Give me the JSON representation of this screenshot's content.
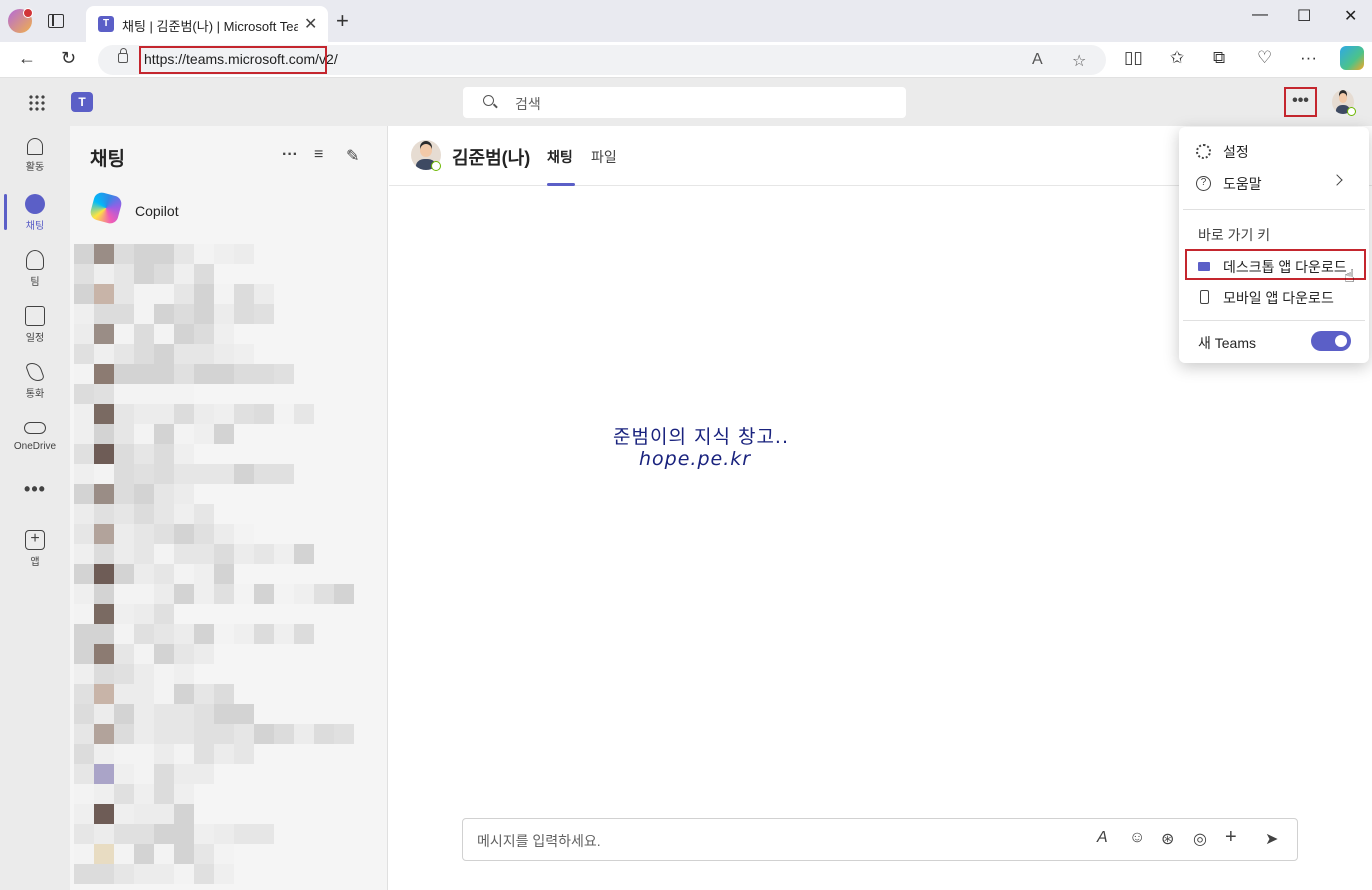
{
  "browser": {
    "tab_title": "채팅 | 김준범(나) | Microsoft Teams",
    "tab_close": "✕",
    "new_tab": "+",
    "minimize": "—",
    "maximize": "☐",
    "close": "✕",
    "url": "https://teams.microsoft.com/v2/",
    "read_aloud": "A",
    "favorite": "☆",
    "split": "▯▯",
    "favorites_bar": "✩",
    "collections": "⧉",
    "heart": "♡",
    "more": "···"
  },
  "teams": {
    "logo": "T",
    "search_placeholder": "검색",
    "more_label": "•••"
  },
  "rail": {
    "items": [
      {
        "label": "활동",
        "icon": "bell-icon"
      },
      {
        "label": "채팅",
        "icon": "chat-icon"
      },
      {
        "label": "팀",
        "icon": "teams-icon"
      },
      {
        "label": "일정",
        "icon": "calendar-icon"
      },
      {
        "label": "통화",
        "icon": "phone-icon"
      },
      {
        "label": "OneDrive",
        "icon": "cloud-icon"
      }
    ],
    "more": "•••",
    "apps_label": "앱",
    "apps_icon": "+"
  },
  "chat_list": {
    "title": "채팅",
    "more": "···",
    "filter": "≡",
    "compose": "✎",
    "copilot_name": "Copilot"
  },
  "main": {
    "name": "김준범(나)",
    "tabs": [
      "채팅",
      "파일"
    ],
    "watermark_line1": "준범이의 지식 창고..",
    "watermark_line2": "hope.pe.kr",
    "compose_placeholder": "메시지를 입력하세요.",
    "compose_tools": [
      "A",
      "☺",
      "⊛",
      "◎",
      "+",
      "➤"
    ]
  },
  "menu": {
    "settings": "설정",
    "help": "도움말",
    "help_icon": "?",
    "section": "바로 가기 키",
    "desktop": "데스크톱 앱 다운로드",
    "mobile": "모바일 앱 다운로드",
    "new_teams": "새 Teams",
    "new_teams_on": true
  },
  "colors": {
    "accent": "#5b5fc7",
    "highlight_box": "#c4262e",
    "watermark": "#1a237e"
  }
}
